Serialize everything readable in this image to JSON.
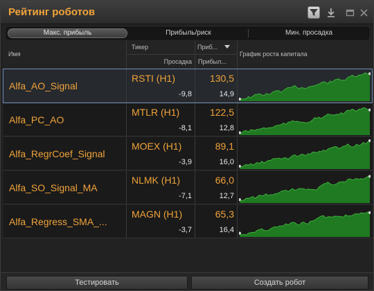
{
  "window": {
    "title": "Рейтинг роботов"
  },
  "toolbar_icons": [
    "filter-icon",
    "download-icon",
    "minimize-icon",
    "close-icon"
  ],
  "tabs": [
    {
      "label": "Макс. прибыль",
      "active": true
    },
    {
      "label": "Прибыль/риск",
      "active": false
    },
    {
      "label": "Мин. просадка",
      "active": false
    }
  ],
  "columns": {
    "name": "Имя",
    "ticker": "Тикер",
    "drawdown": "Просадка",
    "profit": "Приб...",
    "ratio": "Прибыл...",
    "chart": "График роста капитала"
  },
  "rows": [
    {
      "name": "Alfa_AO_Signal",
      "ticker": "RSTI (H1)",
      "drawdown": "-9,8",
      "profit": "130,5",
      "ratio": "14,9",
      "selected": true
    },
    {
      "name": "Alfa_PC_AO",
      "ticker": "MTLR (H1)",
      "drawdown": "-8,1",
      "profit": "122,5",
      "ratio": "12,8",
      "selected": false
    },
    {
      "name": "Alfa_RegrCoef_Signal",
      "ticker": "MOEX (H1)",
      "drawdown": "-3,9",
      "profit": "89,1",
      "ratio": "16,0",
      "selected": false
    },
    {
      "name": "Alfa_SO_Signal_MA",
      "ticker": "NLMK (H1)",
      "drawdown": "-7,1",
      "profit": "66,0",
      "ratio": "12,7",
      "selected": false
    },
    {
      "name": "Alfa_Regress_SMA_...",
      "ticker": "MAGN (H1)",
      "drawdown": "-3,7",
      "profit": "65,3",
      "ratio": "16,4",
      "selected": false
    }
  ],
  "buttons": {
    "test": "Тестировать",
    "create": "Создать робот"
  },
  "colors": {
    "accent": "#f0a33a",
    "chart_fill": "#1f7a22",
    "chart_line": "#3fae3a"
  }
}
